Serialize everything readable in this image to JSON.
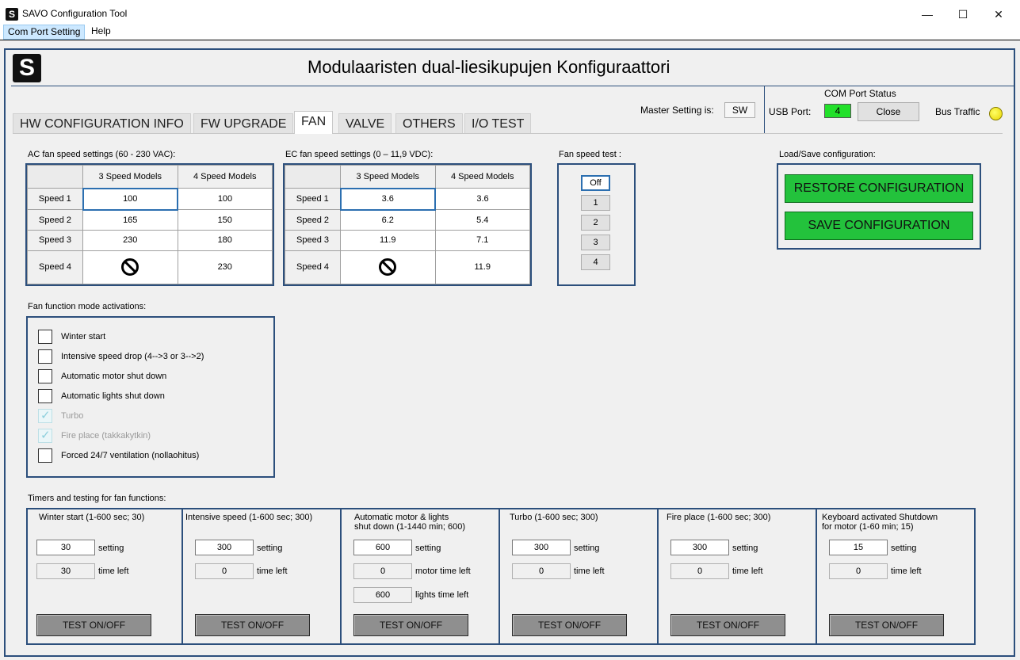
{
  "window": {
    "title": "SAVO Configuration Tool",
    "icon_letter": "S",
    "controls": {
      "minimize": "—",
      "maximize": "☐",
      "close": "✕"
    }
  },
  "menu": {
    "items": [
      "Com Port Setting",
      "Help"
    ]
  },
  "header": {
    "logo_letter": "S",
    "title": "Modulaaristen dual-liesikupujen Konfiguraattori"
  },
  "tabs": [
    "HW CONFIGURATION INFO",
    "FW UPGRADE",
    "FAN",
    "VALVE",
    "OTHERS",
    "I/O TEST"
  ],
  "active_tab": "FAN",
  "master": {
    "label": "Master Setting is:",
    "value": "SW"
  },
  "com_port": {
    "status_title": "COM Port Status",
    "usb_label": "USB Port:",
    "usb_value": "4",
    "close_label": "Close",
    "bus_label": "Bus Traffic",
    "usb_color": "#22e02a",
    "led_color": "#f2e600"
  },
  "ac_fan": {
    "title": "AC fan speed settings (60 - 230 VAC):",
    "headers": [
      "3 Speed Models",
      "4 Speed Models"
    ],
    "rows": [
      {
        "label": "Speed 1",
        "v3": "100",
        "v4": "100"
      },
      {
        "label": "Speed 2",
        "v3": "165",
        "v4": "150"
      },
      {
        "label": "Speed 3",
        "v3": "230",
        "v4": "180"
      },
      {
        "label": "Speed 4",
        "v3": "",
        "v4": "230"
      }
    ]
  },
  "ec_fan": {
    "title": "EC fan speed settings (0 – 11,9 VDC):",
    "headers": [
      "3 Speed Models",
      "4 Speed Models"
    ],
    "rows": [
      {
        "label": "Speed 1",
        "v3": "3.6",
        "v4": "3.6"
      },
      {
        "label": "Speed 2",
        "v3": "6.2",
        "v4": "5.4"
      },
      {
        "label": "Speed 3",
        "v3": "11.9",
        "v4": "7.1"
      },
      {
        "label": "Speed 4",
        "v3": "",
        "v4": "11.9"
      }
    ]
  },
  "fan_speed_test": {
    "title": "Fan speed test :",
    "buttons": [
      "Off",
      "1",
      "2",
      "3",
      "4"
    ],
    "selected": "Off"
  },
  "load_save": {
    "title": "Load/Save configuration:",
    "restore_label": "RESTORE CONFIGURATION",
    "save_label": "SAVE CONFIGURATION",
    "button_color": "#23c23c"
  },
  "fan_modes": {
    "title": "Fan function mode activations:",
    "items": [
      {
        "label": "Winter start",
        "checked": false,
        "disabled": false
      },
      {
        "label": "Intensive speed drop (4-->3 or 3-->2)",
        "checked": false,
        "disabled": false
      },
      {
        "label": "Automatic motor shut down",
        "checked": false,
        "disabled": false
      },
      {
        "label": "Automatic lights shut down",
        "checked": false,
        "disabled": false
      },
      {
        "label": "Turbo",
        "checked": true,
        "disabled": true
      },
      {
        "label": "Fire place (takkakytkin)",
        "checked": true,
        "disabled": true
      },
      {
        "label": "Forced 24/7 ventilation (nollaohitus)",
        "checked": false,
        "disabled": false
      }
    ]
  },
  "timers": {
    "title": "Timers  and testing for  fan functions:",
    "setting_label": "setting",
    "time_left_label": "time left",
    "test_label": "TEST ON/OFF",
    "columns": [
      {
        "title1": "Winter start (1-600 sec; 30)",
        "title2": "",
        "setting": "30",
        "left": "30"
      },
      {
        "title1": "Intensive speed (1-600 sec; 300)",
        "title2": "",
        "setting": "300",
        "left": "0"
      },
      {
        "title1": "Automatic motor & lights",
        "title2": "shut down (1-1440 min; 600)",
        "setting": "600",
        "left": "0",
        "left_label": "motor time left",
        "extra": "600",
        "extra_label": "lights time left"
      },
      {
        "title1": "Turbo (1-600 sec; 300)",
        "title2": "",
        "setting": "300",
        "left": "0"
      },
      {
        "title1": "Fire place (1-600 sec; 300)",
        "title2": "",
        "setting": "300",
        "left": "0"
      },
      {
        "title1": "Keyboard activated Shutdown",
        "title2": "for motor (1-60 min; 15)",
        "setting": "15",
        "left": "0"
      }
    ]
  }
}
